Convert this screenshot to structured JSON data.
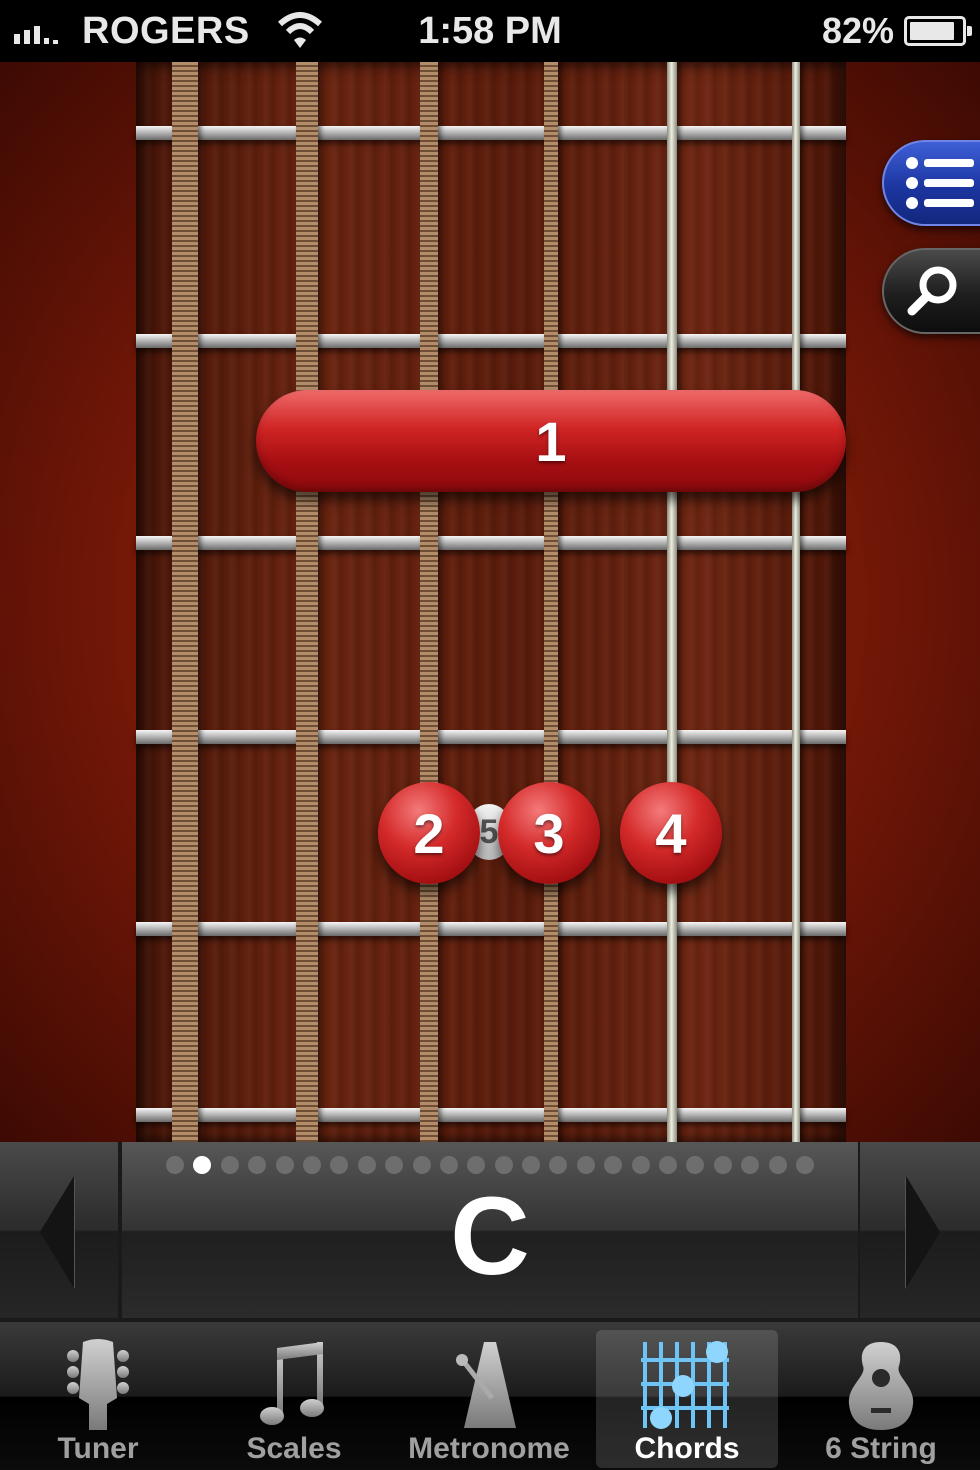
{
  "status_bar": {
    "carrier": "ROGERS",
    "time": "1:58 PM",
    "battery": "82%"
  },
  "chord_diagram": {
    "barre_label": "1",
    "fret_marker": "5",
    "fingers": [
      {
        "label": "2"
      },
      {
        "label": "3"
      },
      {
        "label": "4"
      }
    ]
  },
  "side_buttons": {
    "list": "list-icon",
    "search": "search-icon"
  },
  "chord_selector": {
    "chord": "C",
    "page_count": 24,
    "active_page": 2
  },
  "tab_bar": {
    "tabs": [
      {
        "label": "Tuner",
        "icon": "guitar-headstock-icon",
        "active": false
      },
      {
        "label": "Scales",
        "icon": "music-note-icon",
        "active": false
      },
      {
        "label": "Metronome",
        "icon": "metronome-icon",
        "active": false
      },
      {
        "label": "Chords",
        "icon": "chord-grid-icon",
        "active": true
      },
      {
        "label": "6 String",
        "icon": "guitar-body-icon",
        "active": false
      }
    ]
  },
  "colors": {
    "accent_red": "#c81e1e",
    "list_button_blue": "#1c36a0",
    "active_tab_icon": "#6ec4f5"
  }
}
